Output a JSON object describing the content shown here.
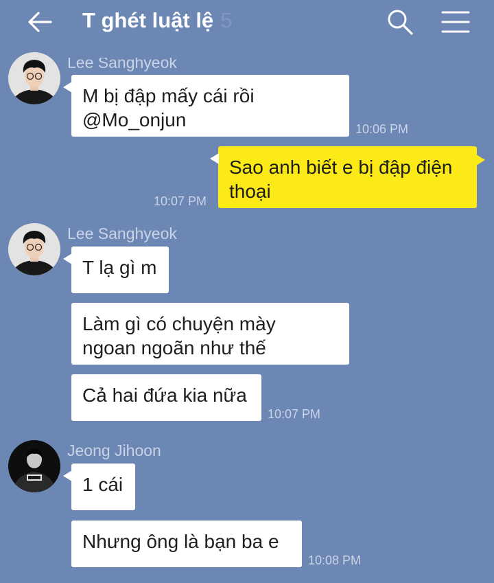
{
  "header": {
    "title": "T ghét luật lệ",
    "member_count": "5",
    "back_icon": "back-arrow-icon",
    "search_icon": "search-icon",
    "menu_icon": "menu-icon"
  },
  "colors": {
    "background": "#6c87b4",
    "incoming_bubble": "#ffffff",
    "outgoing_bubble": "#fbea18"
  },
  "messages": [
    {
      "sender": "Lee Sanghyeok",
      "text": "M bị đập mấy cái rồi\n@Mo_onjun",
      "time": "10:06 PM"
    },
    {
      "sender": "me",
      "text": "Sao anh biết e bị đập điện\nthoại",
      "time": "10:07 PM"
    },
    {
      "sender": "Lee Sanghyeok",
      "text": "T lạ gì m"
    },
    {
      "sender": "Lee Sanghyeok",
      "text": "Làm gì có chuyện mày\nngoan ngoãn như thế"
    },
    {
      "sender": "Lee Sanghyeok",
      "text": "Cả hai đứa kia nữa",
      "time": "10:07 PM"
    },
    {
      "sender": "Jeong Jihoon",
      "text": "1 cái"
    },
    {
      "sender": "Jeong Jihoon",
      "text": "Nhưng ông là bạn ba e",
      "time": "10:08 PM"
    }
  ]
}
